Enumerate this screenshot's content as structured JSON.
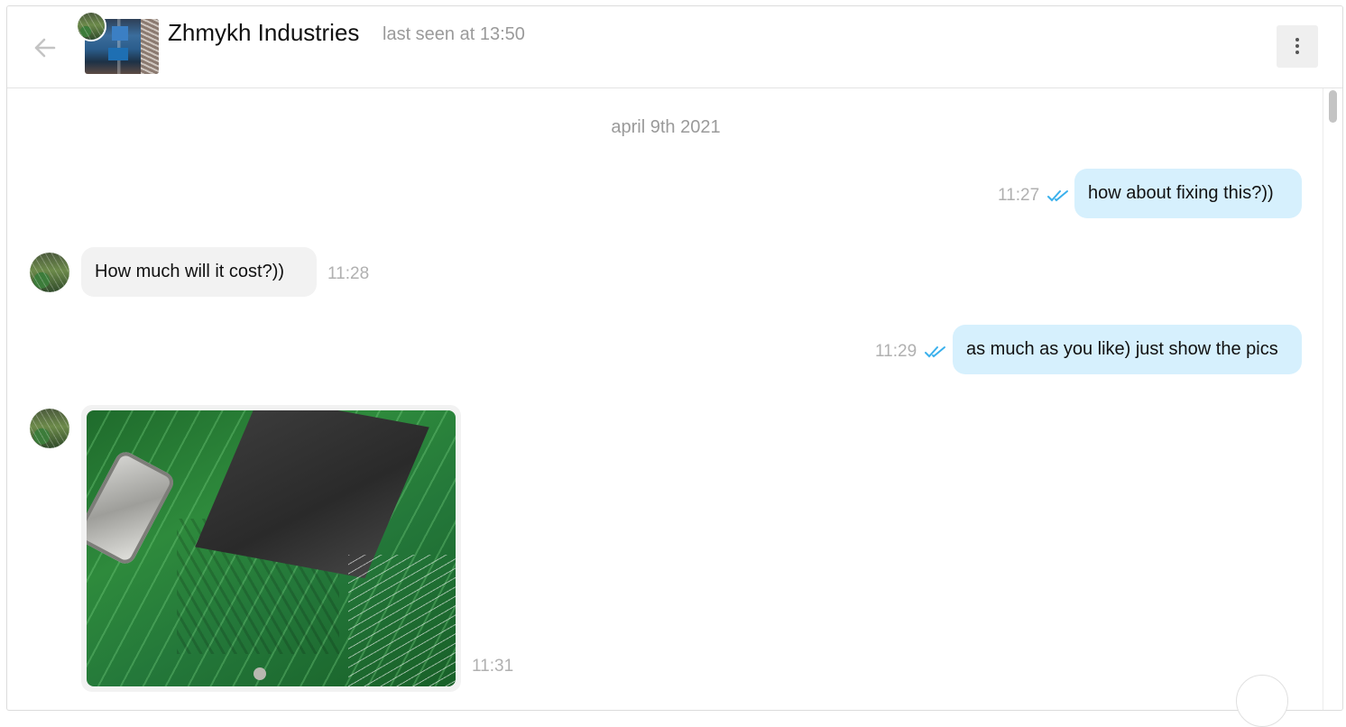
{
  "header": {
    "back_icon": "arrow-left-icon",
    "contact_name": "Zhmykh Industries",
    "status": "last seen at 13:50",
    "menu_icon": "more-vertical-icon"
  },
  "chat": {
    "date_separator": "april 9th 2021",
    "messages": [
      {
        "direction": "out",
        "text": "how about fixing this?))",
        "time": "11:27",
        "status_icon": "double-check-icon"
      },
      {
        "direction": "in",
        "text": "How much will it cost?))",
        "time": "11:28"
      },
      {
        "direction": "out",
        "text": "as much as you like) just show the pics",
        "time": "11:29",
        "status_icon": "double-check-icon"
      },
      {
        "direction": "in",
        "type": "photo",
        "time": "11:31"
      }
    ]
  },
  "colors": {
    "outgoing_bubble": "#d6f0fd",
    "incoming_bubble": "#f2f2f2",
    "read_check": "#3ab0ec",
    "timestamp": "#b0b0b0"
  }
}
